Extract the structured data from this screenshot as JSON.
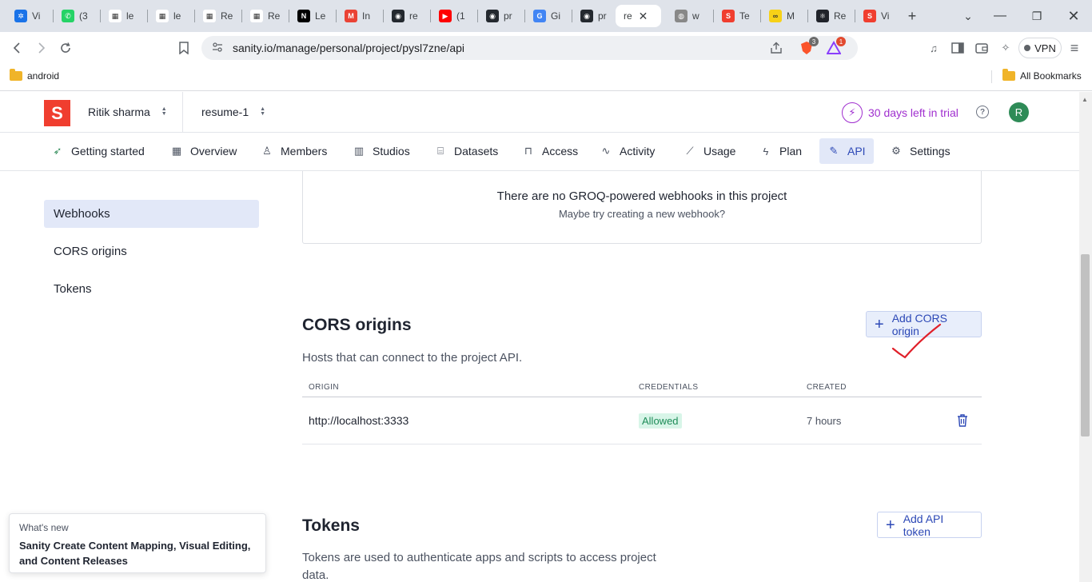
{
  "browser": {
    "tabs": [
      {
        "label": "Vi",
        "fav_color": "#1a73e8",
        "fav_glyph": "✲"
      },
      {
        "label": "(3",
        "fav_color": "#25d366",
        "fav_glyph": "✆"
      },
      {
        "label": "le",
        "fav_color": "#ffffff",
        "fav_glyph": "▦"
      },
      {
        "label": "le",
        "fav_color": "#ffffff",
        "fav_glyph": "▦"
      },
      {
        "label": "Re",
        "fav_color": "#ffffff",
        "fav_glyph": "▦"
      },
      {
        "label": "Re",
        "fav_color": "#ffffff",
        "fav_glyph": "▦"
      },
      {
        "label": "Le",
        "fav_color": "#000000",
        "fav_glyph": "N"
      },
      {
        "label": "In",
        "fav_color": "#ea4335",
        "fav_glyph": "M"
      },
      {
        "label": "re",
        "fav_color": "#24292f",
        "fav_glyph": "◉"
      },
      {
        "label": "(1",
        "fav_color": "#ff0000",
        "fav_glyph": "▶"
      },
      {
        "label": "pr",
        "fav_color": "#24292f",
        "fav_glyph": "◉"
      },
      {
        "label": "Gi",
        "fav_color": "#4285f4",
        "fav_glyph": "G"
      },
      {
        "label": "pr",
        "fav_color": "#24292f",
        "fav_glyph": "◉"
      },
      {
        "label": "re",
        "fav_color": "#ffffff",
        "fav_glyph": "",
        "active": true
      },
      {
        "label": "w",
        "fav_color": "#888888",
        "fav_glyph": "◍"
      },
      {
        "label": "Te",
        "fav_color": "#f03e2f",
        "fav_glyph": "S"
      },
      {
        "label": "M",
        "fav_color": "#f7d117",
        "fav_glyph": "∞"
      },
      {
        "label": "Re",
        "fav_color": "#20232a",
        "fav_glyph": "⚛"
      },
      {
        "label": "Vi",
        "fav_color": "#f03e2f",
        "fav_glyph": "S"
      }
    ],
    "url": "sanity.io/manage/personal/project/pysl7zne/api",
    "brave_badge": "3",
    "alert_badge": "1",
    "vpn_label": "VPN",
    "bookmark_android": "android",
    "bookmark_all": "All Bookmarks"
  },
  "header": {
    "org_name": "Ritik sharma",
    "project_name": "resume-1",
    "trial_text": "30 days left in trial",
    "avatar_initial": "R",
    "logo_letter": "S"
  },
  "nav": {
    "items": [
      {
        "label": "Getting started",
        "icon": "rocket-icon"
      },
      {
        "label": "Overview",
        "icon": "grid-icon"
      },
      {
        "label": "Members",
        "icon": "users-icon"
      },
      {
        "label": "Studios",
        "icon": "layout-icon"
      },
      {
        "label": "Datasets",
        "icon": "database-icon"
      },
      {
        "label": "Access",
        "icon": "lock-icon"
      },
      {
        "label": "Activity",
        "icon": "activity-icon"
      },
      {
        "label": "Usage",
        "icon": "chart-icon"
      },
      {
        "label": "Plan",
        "icon": "bolt-icon"
      },
      {
        "label": "API",
        "icon": "plug-icon",
        "active": true
      },
      {
        "label": "Settings",
        "icon": "gear-icon"
      }
    ]
  },
  "sidebar": {
    "items": [
      {
        "label": "Webhooks",
        "active": true
      },
      {
        "label": "CORS origins"
      },
      {
        "label": "Tokens"
      }
    ]
  },
  "webhooks": {
    "empty_title": "There are no GROQ-powered webhooks in this project",
    "empty_sub": "Maybe try creating a new webhook?"
  },
  "cors": {
    "title": "CORS origins",
    "description": "Hosts that can connect to the project API.",
    "add_label": "Add CORS origin",
    "columns": [
      "ORIGIN",
      "CREDENTIALS",
      "CREATED"
    ],
    "rows": [
      {
        "origin": "http://localhost:3333",
        "credentials": "Allowed",
        "created": "7 hours"
      }
    ]
  },
  "tokens": {
    "title": "Tokens",
    "description": "Tokens are used to authenticate apps and scripts to access project data.",
    "add_label": "Add API token"
  },
  "whats_new": {
    "label": "What's new",
    "text": "Sanity Create Content Mapping, Visual Editing, and Content Releases"
  },
  "colors": {
    "brand": "#f03e2f",
    "accent": "#2c48b6",
    "trial": "#a02fcf",
    "allowed_bg": "#d8f5e8",
    "annotation": "#e0202a"
  }
}
